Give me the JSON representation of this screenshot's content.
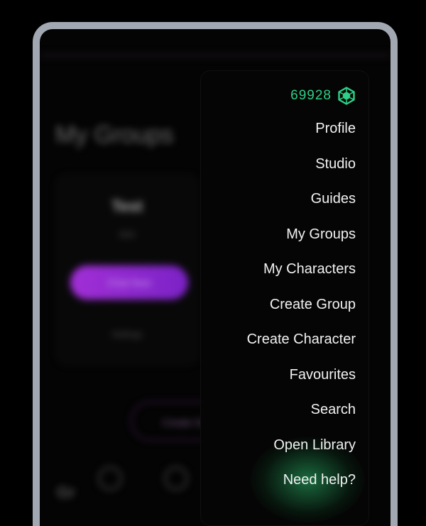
{
  "background": {
    "page_title": "My Groups",
    "card": {
      "name": "Test",
      "subtitle": "test",
      "chat_button": "Chat Now",
      "settings_link": "Settings"
    },
    "create_button": "Create Group",
    "bottom_label": "Gr"
  },
  "menu": {
    "coins": {
      "value": "69928",
      "icon": "gem-icon",
      "color": "#2ecf86"
    },
    "items": [
      "Profile",
      "Studio",
      "Guides",
      "My Groups",
      "My Characters",
      "Create Group",
      "Create Character",
      "Favourites",
      "Search",
      "Open Library",
      "Need help?"
    ]
  }
}
